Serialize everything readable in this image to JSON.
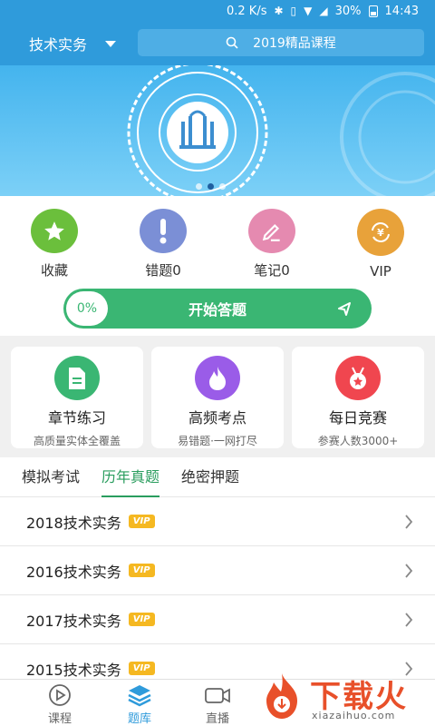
{
  "status_bar": {
    "speed": "0.2 K/s",
    "battery": "30%",
    "time": "14:43"
  },
  "header": {
    "title": "技术实务",
    "search_text": "2019精品课程"
  },
  "banner": {
    "dots": 3,
    "active_dot": 2
  },
  "quick_actions": [
    {
      "label": "收藏",
      "icon": "star-icon",
      "color": "#6bbf3c"
    },
    {
      "label": "错题0",
      "icon": "exclamation-icon",
      "color": "#7b8fd6"
    },
    {
      "label": "笔记0",
      "icon": "pen-icon",
      "color": "#e58ab0"
    },
    {
      "label": "VIP",
      "icon": "yen-refresh-icon",
      "color": "#e8a23a"
    }
  ],
  "start": {
    "progress": "0%",
    "label": "开始答题"
  },
  "features": [
    {
      "title": "章节练习",
      "subtitle": "高质量实体全覆盖",
      "icon": "document-icon",
      "color": "#3ab673"
    },
    {
      "title": "高频考点",
      "subtitle": "易错题·一网打尽",
      "icon": "flame-icon",
      "color": "#9a5ce8"
    },
    {
      "title": "每日竞赛",
      "subtitle": "参赛人数3000+",
      "icon": "medal-icon",
      "color": "#f0464f"
    }
  ],
  "tabs": [
    {
      "label": "模拟考试",
      "active": false
    },
    {
      "label": "历年真题",
      "active": true
    },
    {
      "label": "绝密押题",
      "active": false
    }
  ],
  "list": [
    {
      "title": "2018技术实务",
      "badge": "VIP"
    },
    {
      "title": "2016技术实务",
      "badge": "VIP"
    },
    {
      "title": "2017技术实务",
      "badge": "VIP"
    },
    {
      "title": "2015技术实务",
      "badge": "VIP"
    }
  ],
  "bottom_nav": [
    {
      "label": "课程",
      "icon": "play-icon",
      "active": false
    },
    {
      "label": "题库",
      "icon": "layers-icon",
      "active": true
    },
    {
      "label": "直播",
      "icon": "camera-icon",
      "active": false
    }
  ],
  "watermark": {
    "text": "下载火",
    "url": "xiazaihuo.com"
  }
}
